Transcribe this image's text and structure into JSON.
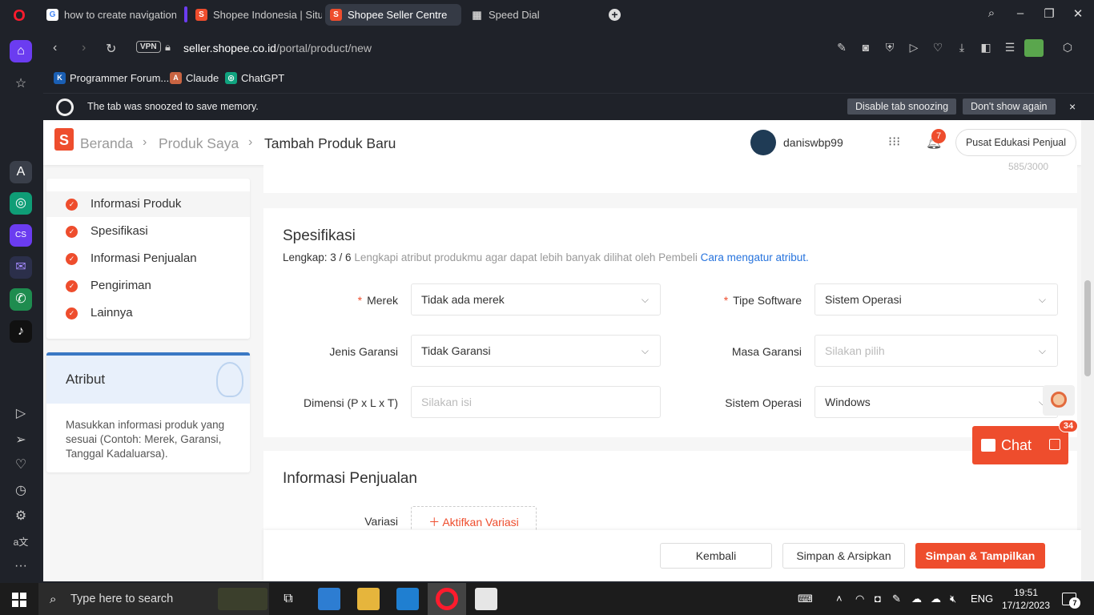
{
  "browser": {
    "tabs": [
      {
        "label": "how to create navigation b",
        "icon": "G",
        "color": "#4285f4"
      },
      {
        "label": "Shopee Indonesia | Situs B",
        "icon": "S",
        "color": "#ee4d2d"
      },
      {
        "label": "Shopee Seller Centre",
        "icon": "S",
        "color": "#ee4d2d"
      },
      {
        "label": "Speed Dial",
        "icon": "▦",
        "color": "#555555"
      }
    ],
    "url_host": "seller.shopee.co.id",
    "url_path": "/portal/product/new",
    "vpn": "VPN",
    "bookmarks": [
      {
        "label": "Programmer Forum...",
        "icon": "K",
        "color": "#1a5fb4"
      },
      {
        "label": "Claude",
        "icon": "A",
        "color": "#c96442"
      },
      {
        "label": "ChatGPT",
        "icon": "◎",
        "color": "#10a37f"
      }
    ],
    "snooze": {
      "text": "The tab was snoozed to save memory.",
      "disable_label": "Disable tab snoozing",
      "dont_show_label": "Don't show again",
      "close": "×"
    }
  },
  "header": {
    "breadcrumb": [
      "Beranda",
      "Produk Saya",
      "Tambah Produk Baru"
    ],
    "username": "daniswbp99",
    "notif_count": "7",
    "edu_label": "Pusat Edukasi Penjual"
  },
  "nav": {
    "items": [
      {
        "label": "Informasi Produk"
      },
      {
        "label": "Spesifikasi"
      },
      {
        "label": "Informasi Penjualan"
      },
      {
        "label": "Pengiriman"
      },
      {
        "label": "Lainnya"
      }
    ]
  },
  "tip": {
    "title": "Atribut",
    "body": "Masukkan informasi produk yang sesuai (Contoh: Merek, Garansi, Tanggal Kadaluarsa)."
  },
  "description": {
    "counter": "585/3000"
  },
  "spec": {
    "title": "Spesifikasi",
    "progress_label": "Lengkap: 3 / 6",
    "hint": "Lengkapi atribut produkmu agar dapat lebih banyak dilihat oleh Pembeli",
    "link": "Cara mengatur atribut.",
    "fields": {
      "merek": {
        "label": "Merek",
        "value": "Tidak ada merek"
      },
      "tipe_software": {
        "label": "Tipe Software",
        "value": "Sistem Operasi"
      },
      "jenis_garansi": {
        "label": "Jenis Garansi",
        "value": "Tidak Garansi"
      },
      "masa_garansi": {
        "label": "Masa Garansi",
        "placeholder": "Silakan pilih"
      },
      "dimensi": {
        "label": "Dimensi (P x L x T)",
        "placeholder": "Silakan isi"
      },
      "sistem_operasi": {
        "label": "Sistem Operasi",
        "value": "Windows"
      }
    }
  },
  "sales": {
    "title": "Informasi Penjualan",
    "variasi_label": "Variasi",
    "variasi_button": "Aktifkan Variasi"
  },
  "footer": {
    "back": "Kembali",
    "save_archive": "Simpan & Arsipkan",
    "save_show": "Simpan & Tampilkan"
  },
  "chat": {
    "label": "Chat",
    "badge": "34"
  },
  "taskbar": {
    "search_placeholder": "Type here to search",
    "language": "ENG",
    "time": "19:51",
    "date": "17/12/2023",
    "notif_count": "7"
  },
  "colors": {
    "brand": "#ee4d2d",
    "link": "#2673dd",
    "opera": "#6b3cf0"
  }
}
